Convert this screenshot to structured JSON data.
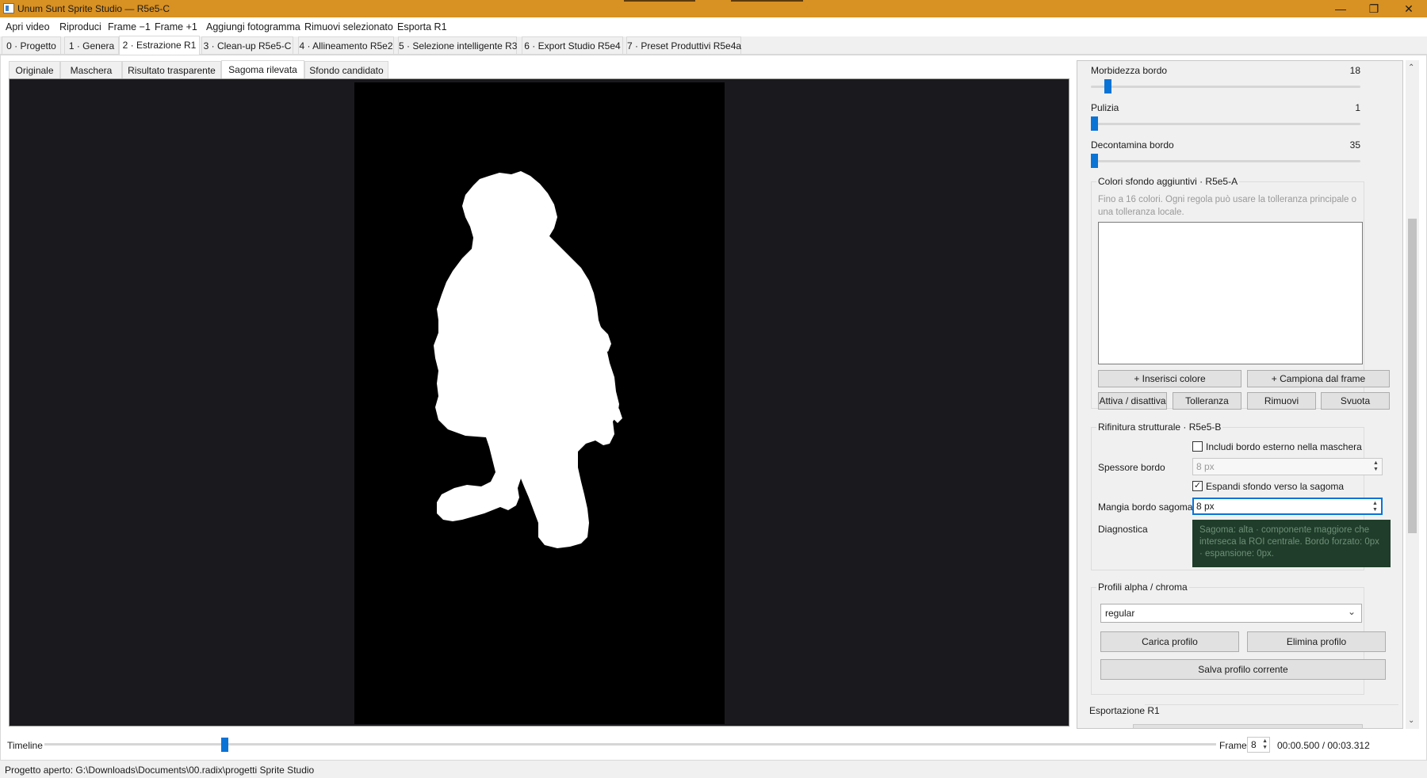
{
  "window": {
    "title": "Unum Sunt Sprite Studio — R5e5-C",
    "accent_color": "#d89123"
  },
  "menu": [
    "Apri video",
    "Riproduci",
    "Frame −1",
    "Frame +1",
    "Aggiungi fotogramma",
    "Rimuovi selezionato",
    "Esporta R1"
  ],
  "main_tabs": [
    "0 · Progetto",
    "1 · Genera",
    "2 · Estrazione R1",
    "3 · Clean-up R5e5-C",
    "4 · Allineamento R5e2",
    "5 · Selezione intelligente R3",
    "6 · Export Studio R5e4",
    "7 · Preset Produttivi R5e4a"
  ],
  "main_tabs_active": 2,
  "sub_tabs": [
    "Originale",
    "Maschera",
    "Risultato trasparente",
    "Sagoma rilevata",
    "Sfondo candidato"
  ],
  "sub_tabs_active": 3,
  "panel": {
    "sliders": [
      {
        "label": "Morbidezza bordo",
        "value": "18",
        "position": 0.05
      },
      {
        "label": "Pulizia",
        "value": "1",
        "position": 0.0
      },
      {
        "label": "Decontamina bordo",
        "value": "35",
        "position": 0.0
      }
    ],
    "colors_group": {
      "title": "Colori sfondo aggiuntivi · R5e5-A",
      "hint": "Fino a 16 colori. Ogni regola può usare la tolleranza principale o una tolleranza locale.",
      "buttons_row1": [
        "+ Inserisci colore",
        "+ Campiona dal frame"
      ],
      "buttons_row2": [
        "Attiva / disattiva",
        "Tolleranza",
        "Rimuovi",
        "Svuota"
      ]
    },
    "refine_group": {
      "title": "Rifinitura strutturale · R5e5-B",
      "include_border_label": "Includi bordo esterno nella maschera",
      "include_border_checked": false,
      "border_thickness_label": "Spessore bordo",
      "border_thickness_value": "8 px",
      "expand_bg_label": "Espandi sfondo verso la sagoma",
      "expand_bg_checked": true,
      "eat_border_label": "Mangia bordo sagoma",
      "eat_border_value": "8 px",
      "diagnostics_label": "Diagnostica",
      "diagnostics_text": "Sagoma: alta · componente maggiore che interseca la ROI centrale. Bordo forzato: 0px · espansione: 0px."
    },
    "profiles_group": {
      "title": "Profili alpha / chroma",
      "selected": "regular",
      "load_button": "Carica profilo",
      "delete_button": "Elimina profilo",
      "save_button": "Salva profilo corrente"
    },
    "export_title": "Esportazione R1"
  },
  "timeline": {
    "label": "Timeline",
    "position": 0.151,
    "frame_label": "Frame",
    "frame_value": "8",
    "time": "00:00.500 / 00:03.312"
  },
  "status": "Progetto aperto: G:\\Downloads\\Documents\\00.radix\\progetti Sprite Studio"
}
